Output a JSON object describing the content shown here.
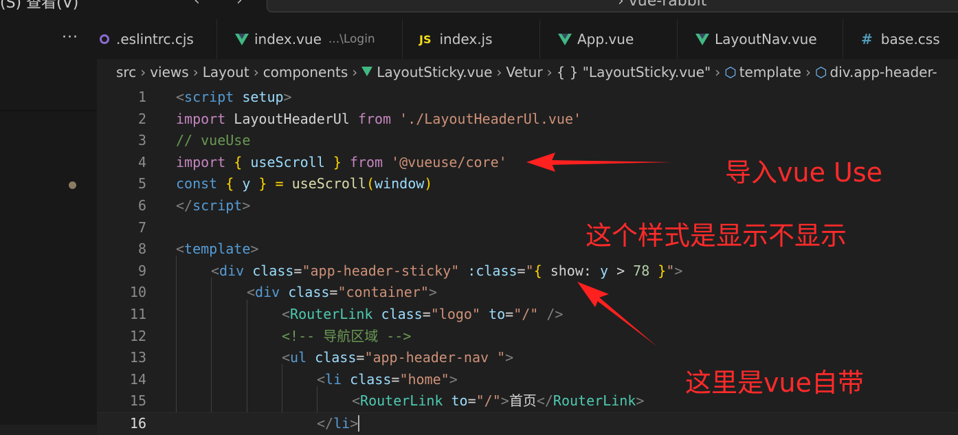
{
  "titlebar": {
    "menu_partial": "(S)    查看(V)",
    "back": "‹",
    "forward": "›",
    "command_center": "›   vue-rabbit"
  },
  "sidebar": {
    "more": "···"
  },
  "tabs": [
    {
      "label": ".eslintrc.cjs",
      "icon": "eslint-icon"
    },
    {
      "label": "index.vue",
      "sub": "...\\Login",
      "icon": "vue-icon"
    },
    {
      "label": "index.js",
      "icon": "js-icon",
      "icon_text": "JS"
    },
    {
      "label": "App.vue",
      "icon": "vue-icon"
    },
    {
      "label": "LayoutNav.vue",
      "icon": "vue-icon"
    },
    {
      "label": "base.css",
      "icon": "css-icon",
      "icon_text": "#"
    }
  ],
  "breadcrumb": [
    "src",
    "views",
    "Layout",
    "components",
    "LayoutSticky.vue",
    "Vetur",
    "{ } \"LayoutSticky.vue\"",
    "template",
    "div.app-header-"
  ],
  "code_lines": [
    "1",
    "2",
    "3",
    "4",
    "5",
    "6",
    "7",
    "8",
    "9",
    "10",
    "11",
    "12",
    "13",
    "14",
    "15",
    "16"
  ],
  "code": {
    "l1a": "<",
    "l1b": "script",
    "l1c": " setup",
    "l1d": ">",
    "l2a": "import",
    "l2b": " LayoutHeaderUl ",
    "l2c": "from",
    "l2d": " './LayoutHeaderUl.vue'",
    "l3": "// vueUse",
    "l4a": "import",
    "l4b": " { ",
    "l4c": "useScroll",
    "l4d": " } ",
    "l4e": "from",
    "l4f": " '@vueuse/core'",
    "l5a": "const",
    "l5b": " { ",
    "l5c": "y",
    "l5d": " } = ",
    "l5e": "useScroll",
    "l5f": "(",
    "l5g": "window",
    "l5h": ")",
    "l6a": "</",
    "l6b": "script",
    "l6c": ">",
    "l8a": "<",
    "l8b": "template",
    "l8c": ">",
    "l9a": "<",
    "l9b": "div",
    "l9c": " class",
    "l9d": "=",
    "l9e": "\"app-header-sticky\"",
    "l9f": " :class",
    "l9g": "=",
    "l9h": "\"",
    "l9i": "{",
    "l9j": " show: ",
    "l9k": "y",
    "l9l": " > ",
    "l9m": "78",
    "l9n": " ",
    "l9o": "}",
    "l9p": "\"",
    "l9q": ">",
    "l10a": "<",
    "l10b": "div",
    "l10c": " class",
    "l10d": "=",
    "l10e": "\"container\"",
    "l10f": ">",
    "l11a": "<",
    "l11b": "RouterLink",
    "l11c": " class",
    "l11d": "=",
    "l11e": "\"logo\"",
    "l11f": " to",
    "l11g": "=",
    "l11h": "\"/\"",
    "l11i": " />",
    "l12": "<!-- 导航区域 -->",
    "l13a": "<",
    "l13b": "ul",
    "l13c": " class",
    "l13d": "=",
    "l13e": "\"app-header-nav \"",
    "l13f": ">",
    "l14a": "<",
    "l14b": "li",
    "l14c": " class",
    "l14d": "=",
    "l14e": "\"home\"",
    "l14f": ">",
    "l15a": "<",
    "l15b": "RouterLink",
    "l15c": " to",
    "l15d": "=",
    "l15e": "\"/\"",
    "l15f": ">",
    "l15g": "首页",
    "l15h": "</",
    "l15i": "RouterLink",
    "l15j": ">",
    "l16a": "</",
    "l16b": "li",
    "l16c": ">"
  },
  "annotations": {
    "a1": "导入vue Use",
    "a2": "这个样式是显示不显示",
    "a3": "这里是vue自带"
  },
  "colors": {
    "annotation": "#ff2a2a",
    "background": "#1f1f1f"
  }
}
